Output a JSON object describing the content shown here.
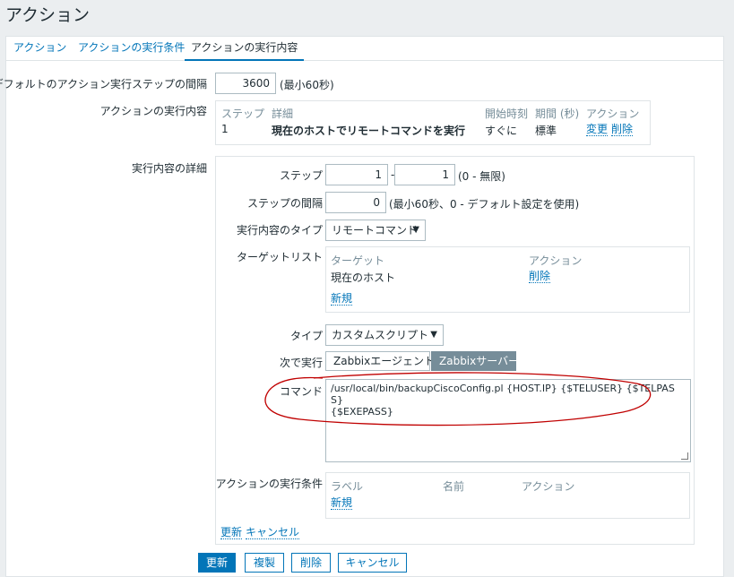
{
  "page": {
    "title": "アクション"
  },
  "tabs": [
    "アクション",
    "アクションの実行条件",
    "アクションの実行内容"
  ],
  "default_step": {
    "label": "デフォルトのアクション実行ステップの間隔",
    "value": "3600",
    "hint": "(最小60秒)"
  },
  "operations": {
    "label": "アクションの実行内容",
    "headers": [
      "ステップ",
      "詳細",
      "開始時刻",
      "期間 (秒)",
      "アクション"
    ],
    "row": {
      "step": "1",
      "detail": "現在のホストでリモートコマンドを実行",
      "start": "すぐに",
      "duration": "標準",
      "edit": "変更",
      "remove": "削除"
    }
  },
  "details": {
    "label": "実行内容の詳細",
    "step_label": "ステップ",
    "step_from": "1",
    "step_sep": "-",
    "step_to": "1",
    "step_hint": "(0 - 無限)",
    "interval_label": "ステップの間隔",
    "interval_value": "0",
    "interval_hint": "(最小60秒、0 - デフォルト設定を使用)",
    "optype_label": "実行内容のタイプ",
    "optype_value": "リモートコマンド",
    "targets_label": "ターゲットリスト",
    "targets_headers": [
      "ターゲット",
      "アクション"
    ],
    "target_row": {
      "name": "現在のホスト",
      "remove": "削除"
    },
    "target_new": "新規",
    "type_label": "タイプ",
    "type_value": "カスタムスクリプト",
    "exec_label": "次で実行",
    "exec_agent": "Zabbixエージェント",
    "exec_server": "Zabbixサーバー",
    "command_label": "コマンド",
    "command_value": "/usr/local/bin/backupCiscoConfig.pl {HOST.IP} {$TELUSER} {$TELPASS}\n{$EXEPASS}",
    "cond_label": "アクションの実行条件",
    "cond_headers": [
      "ラベル",
      "名前",
      "アクション"
    ],
    "cond_new": "新規",
    "update_link": "更新",
    "cancel_link": "キャンセル"
  },
  "buttons": {
    "update": "更新",
    "clone": "複製",
    "delete": "削除",
    "cancel": "キャンセル"
  },
  "colors": {
    "accent": "#0275b8",
    "annotation": "#c00000"
  }
}
